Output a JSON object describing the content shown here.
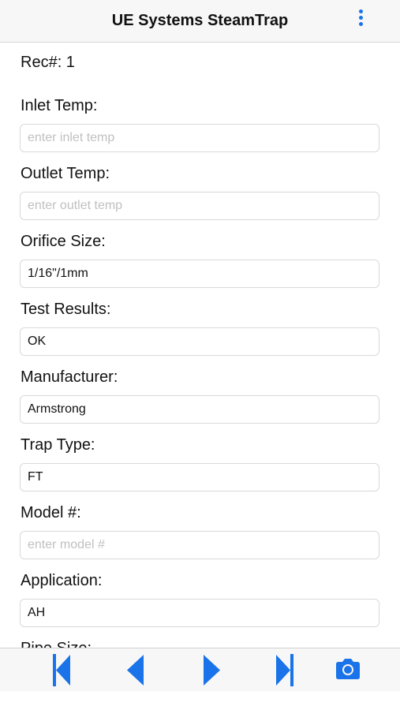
{
  "header": {
    "title": "UE Systems SteamTrap",
    "menu_icon": "more-vertical-icon"
  },
  "record": {
    "label": "Rec#: 1"
  },
  "fields": {
    "inlet_temp": {
      "label": "Inlet Temp:",
      "value": "",
      "placeholder": "enter inlet temp"
    },
    "outlet_temp": {
      "label": "Outlet Temp:",
      "value": "",
      "placeholder": "enter outlet temp"
    },
    "orifice_size": {
      "label": "Orifice Size:",
      "value": "1/16\"/1mm",
      "placeholder": ""
    },
    "test_results": {
      "label": "Test Results:",
      "value": "OK",
      "placeholder": ""
    },
    "manufacturer": {
      "label": "Manufacturer:",
      "value": "Armstrong",
      "placeholder": ""
    },
    "trap_type": {
      "label": "Trap Type:",
      "value": "FT",
      "placeholder": ""
    },
    "model_num": {
      "label": "Model #:",
      "value": "",
      "placeholder": "enter model #"
    },
    "application": {
      "label": "Application:",
      "value": "AH",
      "placeholder": ""
    },
    "pipe_size": {
      "label": "Pipe Size:"
    }
  },
  "toolbar": {
    "items": [
      "first-record-icon",
      "previous-record-icon",
      "next-record-icon",
      "last-record-icon",
      "camera-icon"
    ],
    "accent_color": "#1a73e8"
  }
}
